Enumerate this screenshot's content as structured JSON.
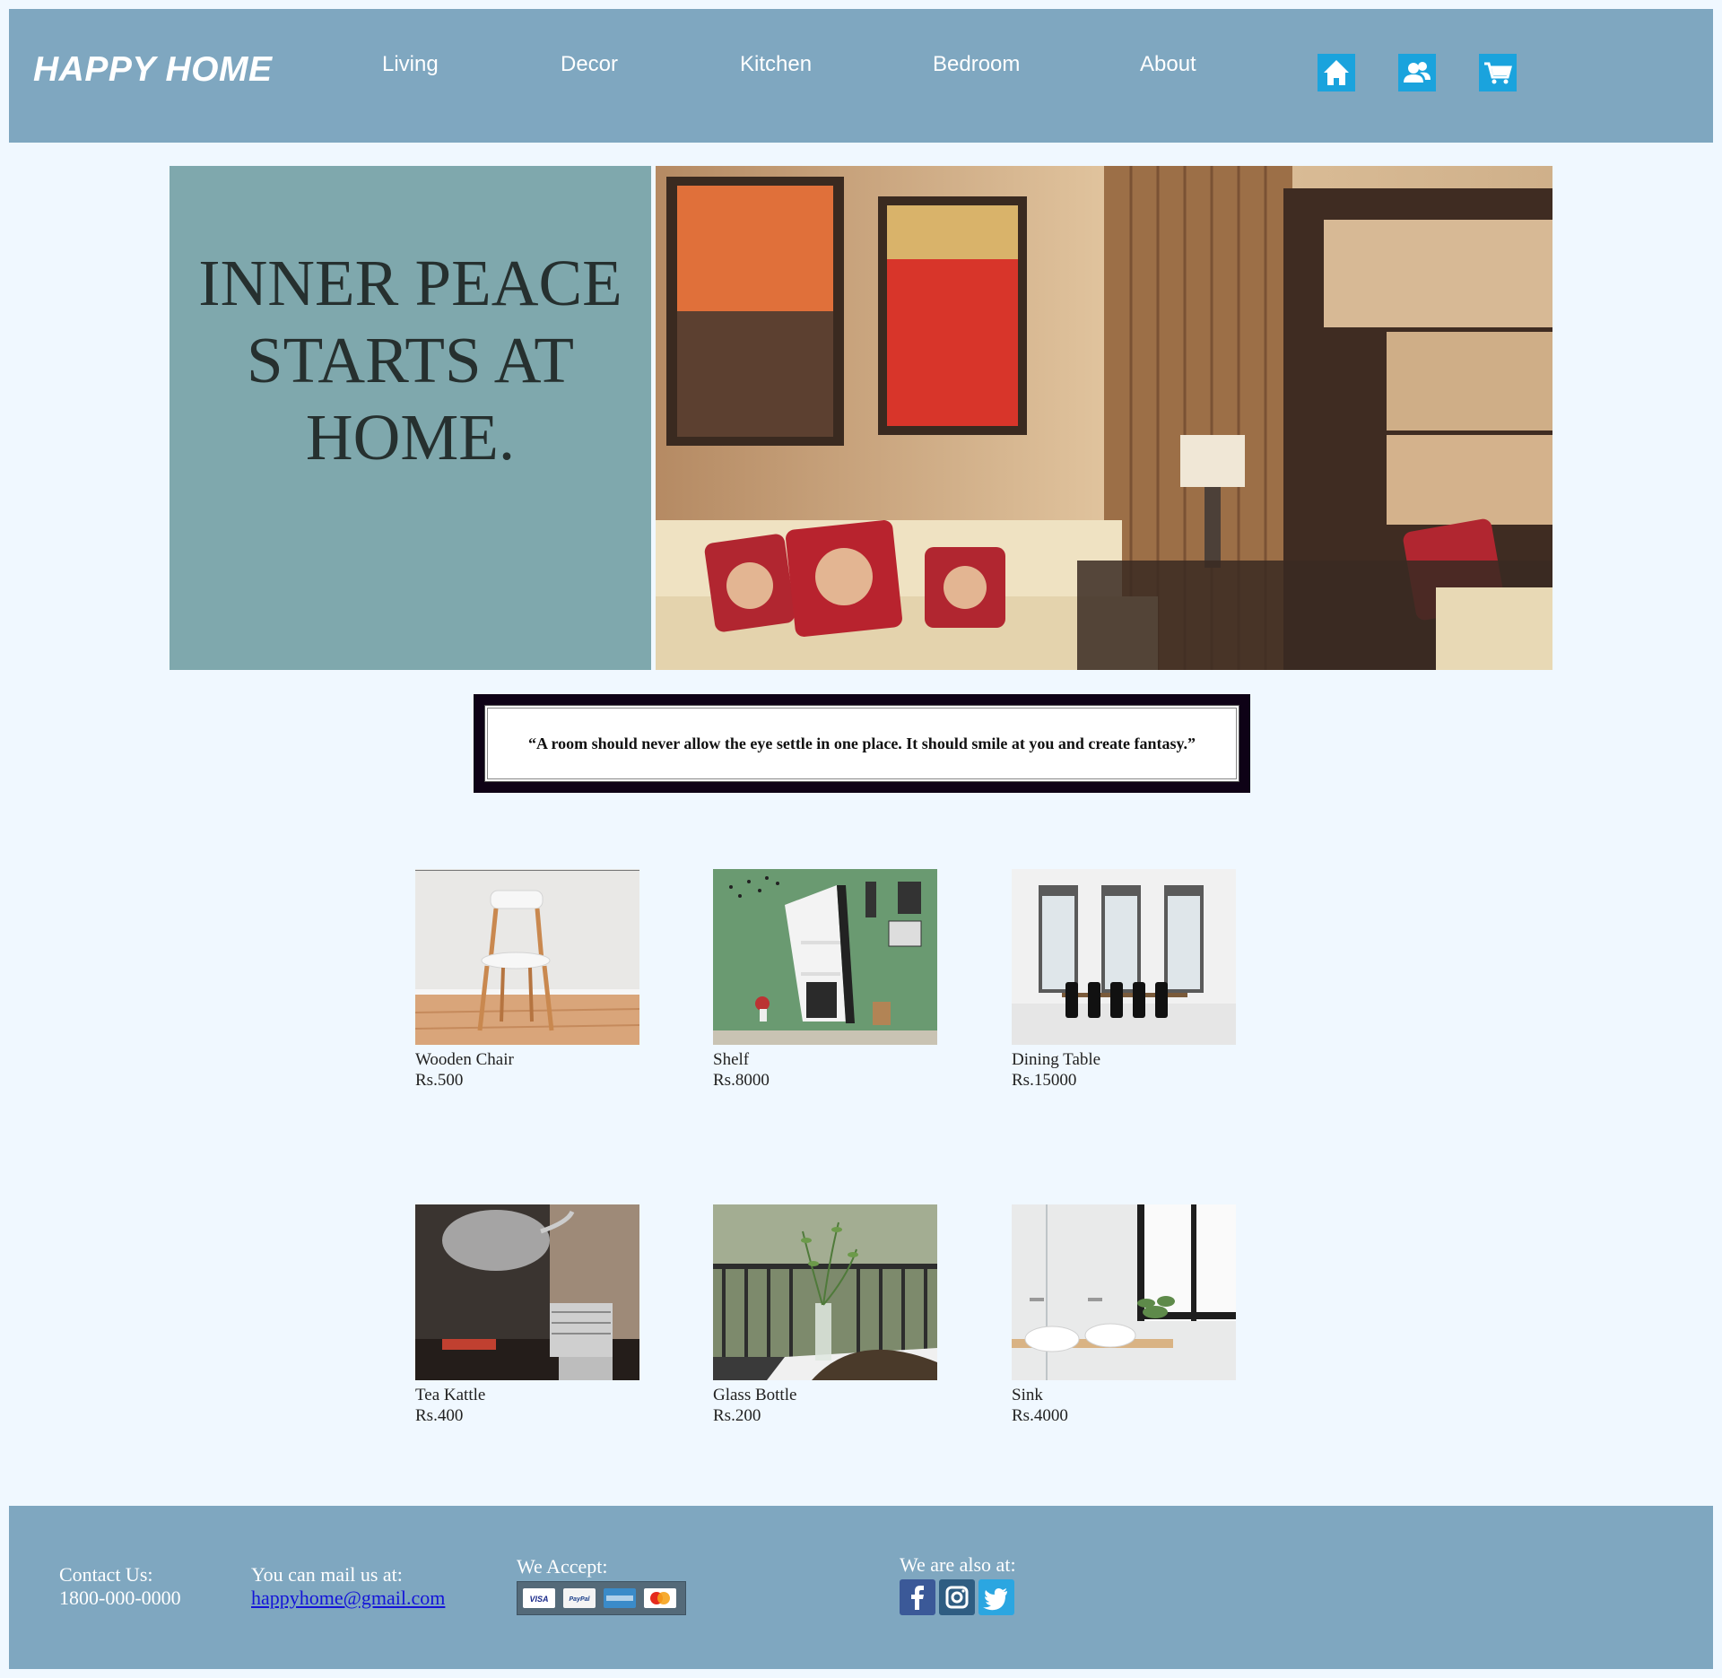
{
  "header": {
    "logo": "HAPPY HOME",
    "nav": [
      "Living",
      "Decor",
      "Kitchen",
      "Bedroom",
      "About"
    ],
    "icons": [
      "home-icon",
      "users-icon",
      "cart-icon"
    ],
    "background_color": "#7fa7c0",
    "icon_color": "#1aa3dd"
  },
  "hero": {
    "lines": [
      "INNER PEACE",
      "STARTS AT",
      "HOME."
    ],
    "panel_color": "#7fa8ad",
    "image": "living-room-photo"
  },
  "quote": {
    "text": "“A room should never allow the eye settle in one place. It should smile at you and create fantasy.”"
  },
  "products": [
    {
      "name": "Wooden Chair",
      "price": "Rs.500",
      "image": "wooden-chair-photo"
    },
    {
      "name": "Shelf",
      "price": "Rs.8000",
      "image": "shelf-photo"
    },
    {
      "name": "Dining Table",
      "price": "Rs.15000",
      "image": "dining-table-photo"
    },
    {
      "name": "Tea Kattle",
      "price": "Rs.400",
      "image": "tea-kettle-photo"
    },
    {
      "name": "Glass Bottle",
      "price": "Rs.200",
      "image": "glass-bottle-photo"
    },
    {
      "name": "Sink",
      "price": "Rs.4000",
      "image": "sink-photo"
    }
  ],
  "footer": {
    "contact_label": "Contact Us:",
    "contact_phone": "1800-000-0000",
    "mail_label": "You can mail us at:",
    "mail_address": "happyhome@gmail.com",
    "accept_label": "We Accept:",
    "cards": [
      "visa-icon",
      "paypal-icon",
      "american-express-icon",
      "mastercard-icon"
    ],
    "social_label": "We are also at:",
    "social": [
      "facebook-icon",
      "instagram-icon",
      "twitter-icon"
    ]
  },
  "page_background": "#f0f8ff"
}
